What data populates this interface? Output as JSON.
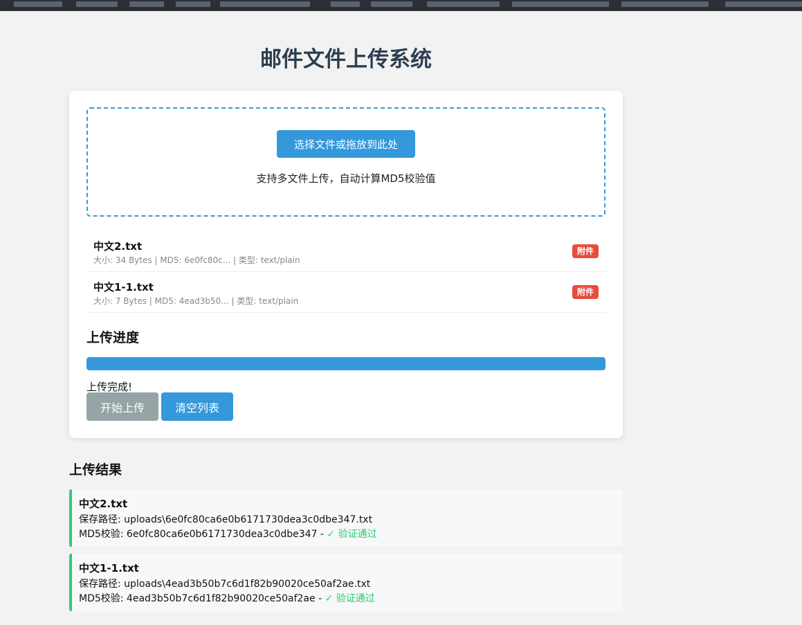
{
  "page": {
    "title": "邮件文件上传系统"
  },
  "upload": {
    "select_button": "选择文件或拖放到此处",
    "hint": "支持多文件上传，自动计算MD5校验值"
  },
  "files": [
    {
      "name": "中文2.txt",
      "meta": "大小: 34 Bytes | MD5: 6e0fc80c... | 类型: text/plain",
      "badge": "附件"
    },
    {
      "name": "中文1-1.txt",
      "meta": "大小: 7 Bytes | MD5: 4ead3b50... | 类型: text/plain",
      "badge": "附件"
    }
  ],
  "progress": {
    "title": "上传进度",
    "percent": 100,
    "status": "上传完成!"
  },
  "actions": {
    "start": "开始上传",
    "clear": "清空列表"
  },
  "results": {
    "title": "上传结果",
    "items": [
      {
        "name": "中文2.txt",
        "path": "保存路径: uploads\\6e0fc80ca6e0b6171730dea3c0dbe347.txt",
        "md5": "MD5校验: 6e0fc80ca6e0b6171730dea3c0dbe347 - ",
        "verified": "✓ 验证通过"
      },
      {
        "name": "中文1-1.txt",
        "path": "保存路径: uploads\\4ead3b50b7c6d1f82b90020ce50af2ae.txt",
        "md5": "MD5校验: 4ead3b50b7c6d1f82b90020ce50af2ae - ",
        "verified": "✓ 验证通过"
      }
    ]
  },
  "colors": {
    "accent": "#3498db",
    "title": "#2c3e50",
    "badge": "#e74c3c",
    "success": "#2ecc71",
    "disabled": "#95a5a6"
  }
}
